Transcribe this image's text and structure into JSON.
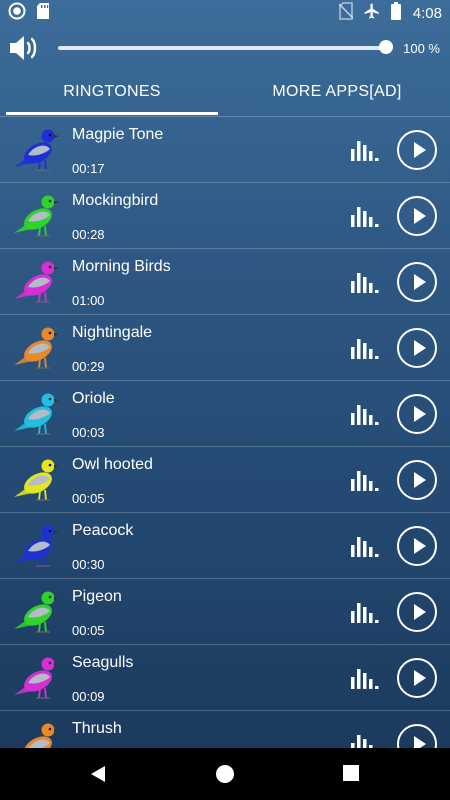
{
  "status_bar": {
    "time": "4:08",
    "icons": [
      "notification-circle-icon",
      "sd-card-icon",
      "no-sim-icon",
      "airplane-icon",
      "battery-icon"
    ]
  },
  "volume": {
    "level_percent": 100,
    "label": "100 %"
  },
  "tabs": [
    {
      "label": "RINGTONES",
      "active": true
    },
    {
      "label": "MORE APPS[AD]",
      "active": false
    }
  ],
  "ringtones": [
    {
      "title": "Magpie Tone",
      "duration": "00:17",
      "bird_color": "#1f2fd6"
    },
    {
      "title": "Mockingbird",
      "duration": "00:28",
      "bird_color": "#2fd42a"
    },
    {
      "title": "Morning Birds",
      "duration": "01:00",
      "bird_color": "#d62fd6"
    },
    {
      "title": "Nightingale",
      "duration": "00:29",
      "bird_color": "#e8892a"
    },
    {
      "title": "Oriole",
      "duration": "00:03",
      "bird_color": "#22bfe0"
    },
    {
      "title": "Owl hooted",
      "duration": "00:05",
      "bird_color": "#e3e51f"
    },
    {
      "title": "Peacock",
      "duration": "00:30",
      "bird_color": "#1f2fd6"
    },
    {
      "title": "Pigeon",
      "duration": "00:05",
      "bird_color": "#2fd42a"
    },
    {
      "title": "Seagulls",
      "duration": "00:09",
      "bird_color": "#d62fd6"
    },
    {
      "title": "Thrush",
      "duration": "",
      "bird_color": "#e8892a"
    }
  ],
  "colors": {
    "background_top": "#3d6d9a",
    "background_bottom": "#1c3a5e",
    "accent": "#ffffff"
  },
  "nav_bar": {
    "icons": [
      "back-icon",
      "home-icon",
      "recents-icon"
    ]
  }
}
